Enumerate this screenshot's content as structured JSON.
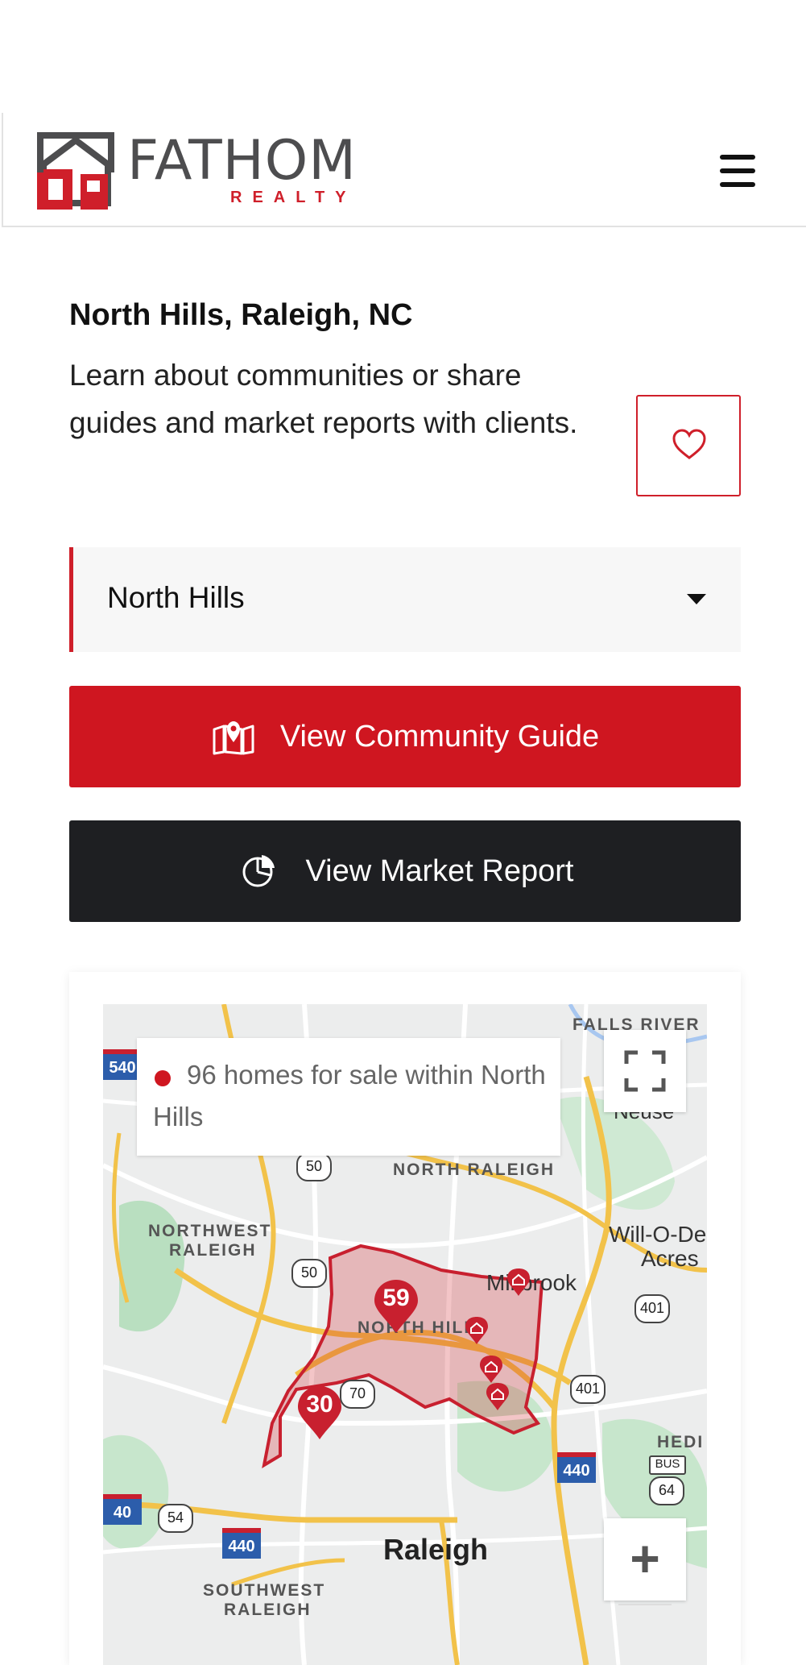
{
  "brand": {
    "name": "FATHOM",
    "tagline": "REALTY",
    "accent": "#cf1620",
    "dark": "#1e1f22"
  },
  "header": {
    "menu_icon": "hamburger-icon"
  },
  "location": {
    "title": "North Hills, Raleigh, NC",
    "description": "Learn about communities or share guides and market reports with clients.",
    "favorite_icon": "heart-icon"
  },
  "community_select": {
    "selected": "North Hills"
  },
  "actions": {
    "community_guide": {
      "label": "View Community Guide",
      "icon": "map-pin-icon"
    },
    "market_report": {
      "label": "View Market Report",
      "icon": "pie-chart-icon"
    }
  },
  "map": {
    "info": "96 homes for sale within North Hills",
    "labels": {
      "falls_river": "FALLS RIVER",
      "neuse": "Neuse",
      "north_raleigh": "NORTH RALEIGH",
      "northwest_raleigh_1": "NORTHWEST",
      "northwest_raleigh_2": "RALEIGH",
      "will_o_dale_1": "Will-O-De",
      "will_o_dale_2": "Acres",
      "millbrook": "Millbrook",
      "north_hills": "NORTH HILLS",
      "hedingham": "HEDI",
      "raleigh": "Raleigh",
      "southwest_raleigh_1": "SOUTHWEST",
      "southwest_raleigh_2": "RALEIGH"
    },
    "shields": {
      "r540": "540",
      "us50a": "50",
      "us50b": "50",
      "us70": "70",
      "us401a": "401",
      "us401b": "401",
      "i440a": "440",
      "i440b": "440",
      "i40": "40",
      "us54": "54",
      "bus": "BUS",
      "us64": "64"
    },
    "clusters": [
      {
        "count": "59"
      },
      {
        "count": "30"
      }
    ],
    "zoom_in_label": "+"
  }
}
